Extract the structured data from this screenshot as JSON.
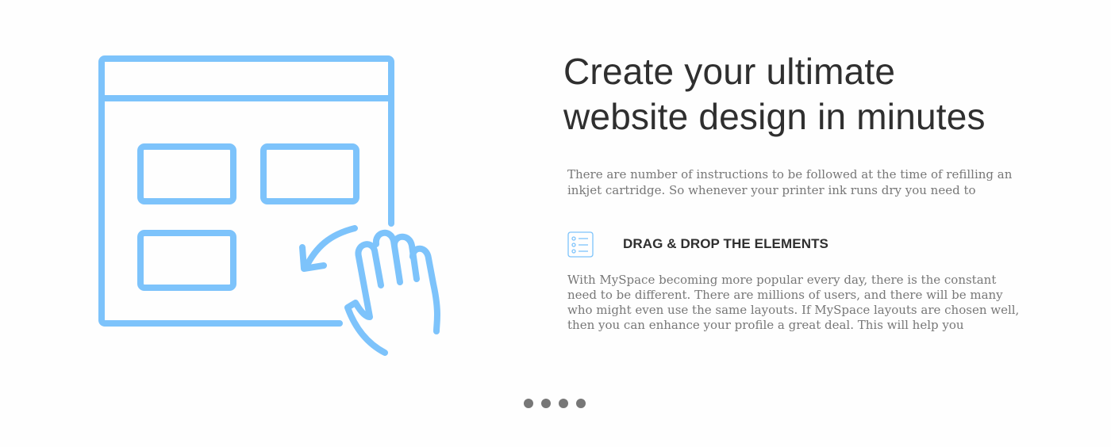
{
  "hero": {
    "illustration_icon": "drag-drop-layout-icon",
    "accent_color": "#7dc3fb",
    "headline": "Create your ultimate website design in minutes",
    "intro": "There are number of instructions to be followed at the time of refilling an inkjet cartridge. So whenever your printer ink runs dry you need to"
  },
  "feature": {
    "icon": "checklist-icon",
    "title": "DRAG & DROP THE ELEMENTS",
    "text": "With MySpace becoming more popular every day, there is the constant need to be different. There are millions of users, and there will be many who might even use the same layouts. If MySpace layouts are chosen well, then you can enhance your profile a great deal. This will help you"
  },
  "pager": {
    "count": 4,
    "dot_color": "#777777"
  }
}
